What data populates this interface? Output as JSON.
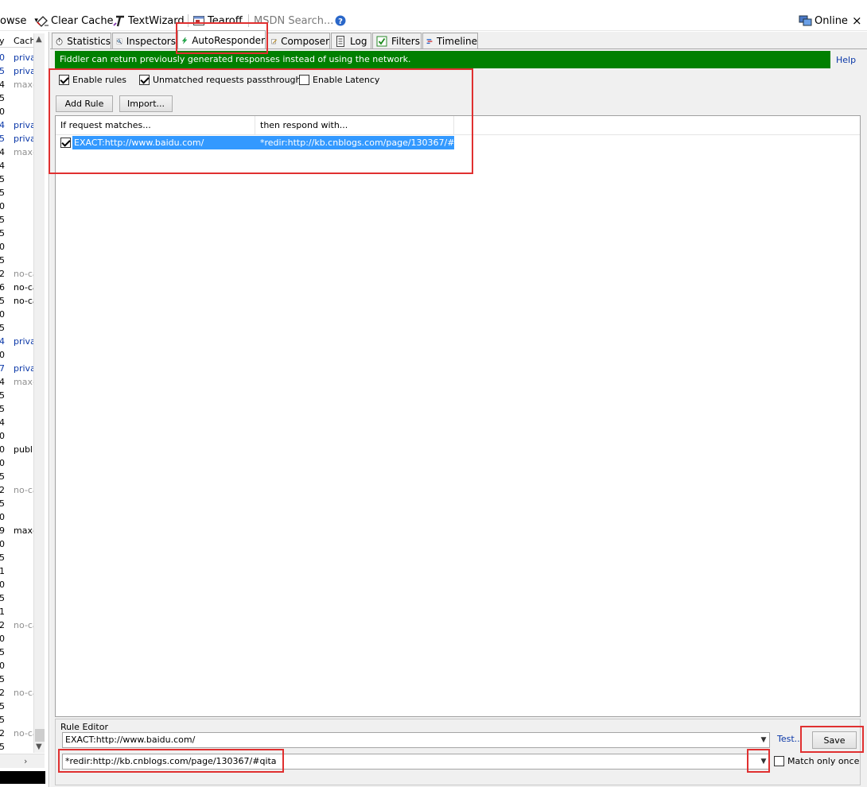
{
  "toolbar": {
    "browse": "owse",
    "clear_cache": "Clear Cache",
    "textwizard": "TextWizard",
    "tearoff": "Tearoff",
    "msdn_search": "MSDN Search...",
    "online": "Online",
    "close": "×"
  },
  "left_panel": {
    "header_col1": "y",
    "header_col2": "Cach",
    "rows": [
      {
        "n": "0",
        "c": "priva",
        "cls": "blue"
      },
      {
        "n": "5",
        "c": "priva",
        "cls": "blue"
      },
      {
        "n": "4",
        "c": "max-",
        "cls": "grey2"
      },
      {
        "n": "5",
        "c": "",
        "cls": ""
      },
      {
        "n": "0",
        "c": "",
        "cls": ""
      },
      {
        "n": "4",
        "c": "priva",
        "cls": "blue"
      },
      {
        "n": "5",
        "c": "priva",
        "cls": "blue"
      },
      {
        "n": "4",
        "c": "max-",
        "cls": "grey2"
      },
      {
        "n": "4",
        "c": "",
        "cls": ""
      },
      {
        "n": "5",
        "c": "",
        "cls": ""
      },
      {
        "n": "5",
        "c": "",
        "cls": ""
      },
      {
        "n": "0",
        "c": "",
        "cls": ""
      },
      {
        "n": "5",
        "c": "",
        "cls": ""
      },
      {
        "n": "5",
        "c": "",
        "cls": ""
      },
      {
        "n": "0",
        "c": "",
        "cls": ""
      },
      {
        "n": "5",
        "c": "",
        "cls": ""
      },
      {
        "n": "2",
        "c": "no-ca",
        "cls": "grey2"
      },
      {
        "n": "6",
        "c": "no-ca",
        "cls": ""
      },
      {
        "n": "5",
        "c": "no-ca",
        "cls": ""
      },
      {
        "n": "0",
        "c": "",
        "cls": ""
      },
      {
        "n": "5",
        "c": "",
        "cls": ""
      },
      {
        "n": "4",
        "c": "priva",
        "cls": "blue"
      },
      {
        "n": "0",
        "c": "",
        "cls": ""
      },
      {
        "n": "7",
        "c": "priva",
        "cls": "blue"
      },
      {
        "n": "4",
        "c": "max-",
        "cls": "grey2"
      },
      {
        "n": "5",
        "c": "",
        "cls": ""
      },
      {
        "n": "5",
        "c": "",
        "cls": ""
      },
      {
        "n": "4",
        "c": "",
        "cls": ""
      },
      {
        "n": "0",
        "c": "",
        "cls": ""
      },
      {
        "n": "0",
        "c": "publi",
        "cls": ""
      },
      {
        "n": "0",
        "c": "",
        "cls": ""
      },
      {
        "n": "5",
        "c": "",
        "cls": ""
      },
      {
        "n": "2",
        "c": "no-ca",
        "cls": "grey2"
      },
      {
        "n": "5",
        "c": "",
        "cls": ""
      },
      {
        "n": "0",
        "c": "",
        "cls": ""
      },
      {
        "n": "9",
        "c": "max-",
        "cls": ""
      },
      {
        "n": "0",
        "c": "",
        "cls": ""
      },
      {
        "n": "5",
        "c": "",
        "cls": ""
      },
      {
        "n": "1",
        "c": "",
        "cls": ""
      },
      {
        "n": "0",
        "c": "",
        "cls": ""
      },
      {
        "n": "5",
        "c": "",
        "cls": ""
      },
      {
        "n": "1",
        "c": "",
        "cls": ""
      },
      {
        "n": "2",
        "c": "no-ca",
        "cls": "grey2"
      },
      {
        "n": "0",
        "c": "",
        "cls": ""
      },
      {
        "n": "5",
        "c": "",
        "cls": ""
      },
      {
        "n": "0",
        "c": "",
        "cls": ""
      },
      {
        "n": "5",
        "c": "",
        "cls": ""
      },
      {
        "n": "2",
        "c": "no-ca",
        "cls": "grey2"
      },
      {
        "n": "5",
        "c": "",
        "cls": ""
      },
      {
        "n": "5",
        "c": "",
        "cls": ""
      },
      {
        "n": "2",
        "c": "no-ca",
        "cls": "grey2"
      },
      {
        "n": "5",
        "c": "",
        "cls": ""
      }
    ]
  },
  "tabs": {
    "statistics": "Statistics",
    "inspectors": "Inspectors",
    "autoresponder": "AutoResponder",
    "composer": "Composer",
    "log": "Log",
    "filters": "Filters",
    "timeline": "Timeline"
  },
  "autoresponder": {
    "banner": "Fiddler can return previously generated responses instead of using the network.",
    "help": "Help",
    "enable_rules": "Enable rules",
    "unmatched_passthrough": "Unmatched requests passthrough",
    "enable_latency": "Enable Latency",
    "add_rule": "Add Rule",
    "import": "Import...",
    "col_match": "If request matches...",
    "col_respond": "then respond with...",
    "rule_match": "EXACT:http://www.baidu.com/",
    "rule_respond": "*redir:http://kb.cnblogs.com/page/130367/#qita"
  },
  "rule_editor": {
    "label": "Rule Editor",
    "match_value": "EXACT:http://www.baidu.com/",
    "respond_value": "*redir:http://kb.cnblogs.com/page/130367/#qita",
    "test": "Test...",
    "save": "Save",
    "match_only_once": "Match only once"
  },
  "colors": {
    "banner_bg": "#008000",
    "selection": "#3399ff",
    "highlight": "#e03030",
    "link": "#0b38a8"
  }
}
